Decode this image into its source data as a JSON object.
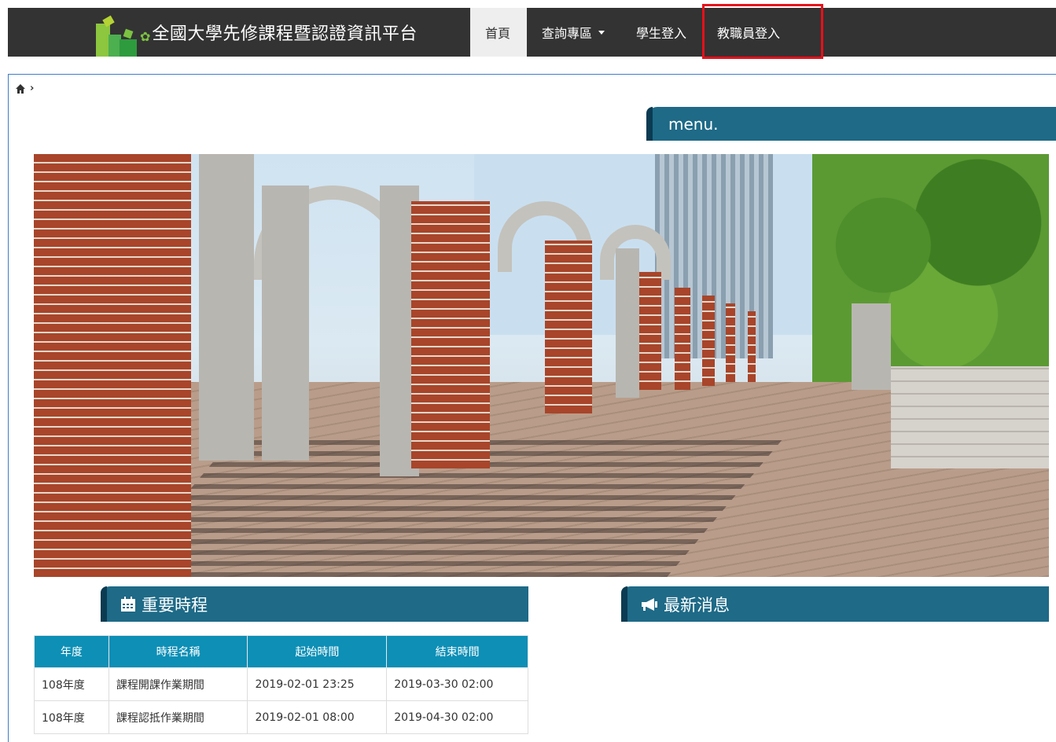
{
  "navbar": {
    "brand_title": "全國大學先修課程暨認證資訊平台",
    "items": [
      {
        "label": "首頁",
        "active": true,
        "dropdown": false
      },
      {
        "label": "查詢專區",
        "active": false,
        "dropdown": true
      },
      {
        "label": "學生登入",
        "active": false,
        "dropdown": false
      },
      {
        "label": "教職員登入",
        "active": false,
        "dropdown": false,
        "highlighted": true
      }
    ]
  },
  "breadcrumb": {
    "home_icon": "home-icon",
    "separator_icon": "chevron-right-icon"
  },
  "menu": {
    "title": "menu."
  },
  "schedule": {
    "title": "重要時程",
    "icon": "calendar-icon",
    "columns": [
      "年度",
      "時程名稱",
      "起始時間",
      "結束時間"
    ],
    "rows": [
      [
        "108年度",
        "課程開課作業期間",
        "2019-02-01 23:25",
        "2019-03-30 02:00"
      ],
      [
        "108年度",
        "課程認抵作業期間",
        "2019-02-01 08:00",
        "2019-04-30 02:00"
      ]
    ]
  },
  "news": {
    "title": "最新消息",
    "icon": "megaphone-icon"
  },
  "colors": {
    "navbar_bg": "#333333",
    "section_header": "#1e6a87",
    "table_header": "#0d8fb6",
    "highlight": "#e8101a"
  }
}
